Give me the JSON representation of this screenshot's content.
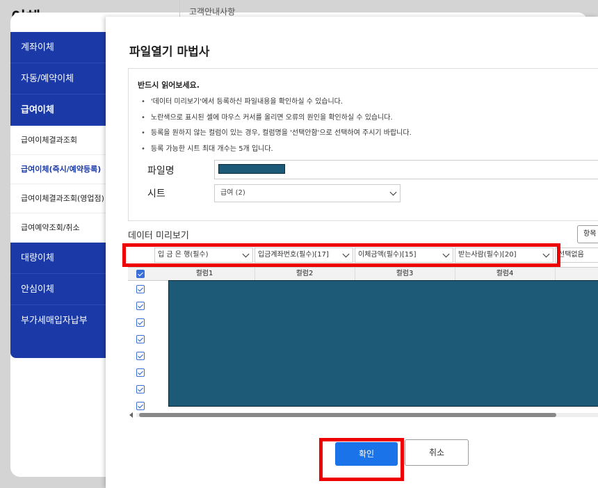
{
  "page": {
    "title": "이체",
    "notice_partial": "고객안내사항"
  },
  "sidebar": {
    "main_items": [
      "계좌이체",
      "자동/예약이체",
      "급여이체"
    ],
    "sub_items": [
      "급여이체결과조회",
      "급여이체(즉시/예약등록)",
      "급여이체결과조회(영업점)",
      "급여예약조회/취소"
    ],
    "more_items": [
      "대량이체",
      "안심이체",
      "부가세매입자납부"
    ]
  },
  "modal": {
    "title": "파일열기 마법사",
    "notice": {
      "heading": "반드시 읽어보세요.",
      "items": [
        "'데이터 미리보기'에서 등록하신 파일내용을 확인하실 수 있습니다.",
        "노란색으로 표시된 셀에 마우스 커서를 올리면 오류의 원인을 확인하실 수 있습니다.",
        "등록을 원하지 않는 컬럼이 있는 경우, 컬럼명을 '선택안함'으로 선택하여 주시기 바랍니다.",
        "등록 가능한 시트 최대 개수는 5개 입니다."
      ]
    },
    "file_label": "파일명",
    "sheet_label": "시트",
    "sheet_value": "급여 (2)",
    "preview_label": "데이터 미리보기",
    "side_button": "항목",
    "column_selects": [
      "입 금 은 행(필수)",
      "입금계좌번호(필수)[17]",
      "이체금액(필수)[15]",
      "받는사람(필수)[20]",
      "선택없음"
    ],
    "column_headers": [
      "컬럼1",
      "컬럼2",
      "컬럼3",
      "컬럼4",
      "컬"
    ],
    "row_count": 8,
    "buttons": {
      "ok": "확인",
      "cancel": "취소"
    }
  },
  "colors": {
    "primary": "#1b3aa8",
    "button": "#1a73e8",
    "highlight": "#e00000",
    "mask": "#1d5a78"
  }
}
